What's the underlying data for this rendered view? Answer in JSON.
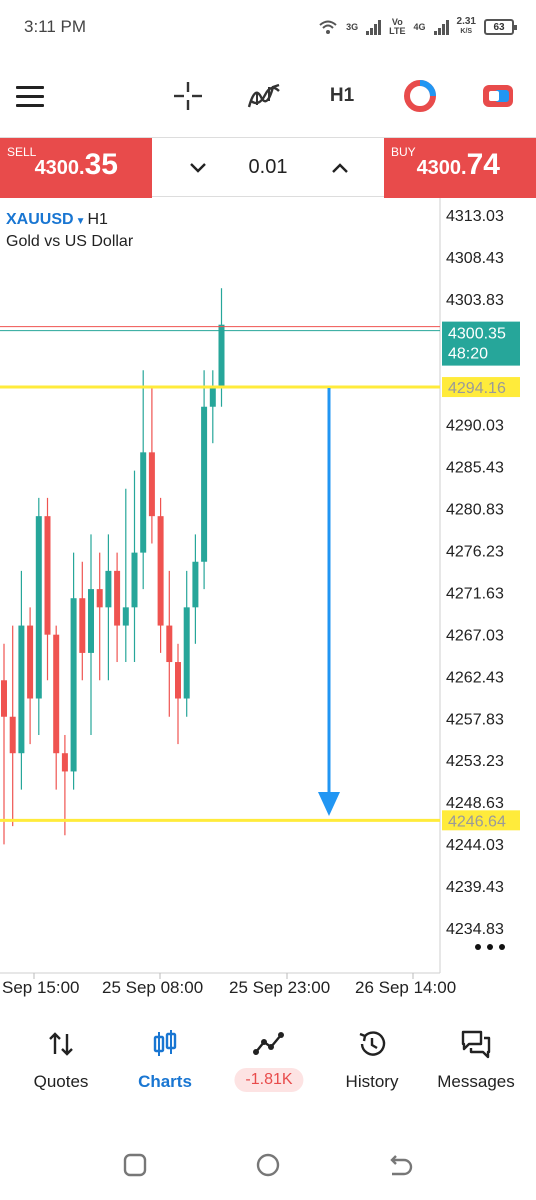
{
  "status_bar": {
    "time": "3:11 PM",
    "net1": "3G",
    "net2_top": "Vo",
    "net2_bottom": "LTE",
    "net3": "4G",
    "speed": "2.31",
    "speed_unit": "K/S",
    "battery": "63"
  },
  "toolbar": {
    "timeframe": "H1",
    "icons": [
      "menu-icon",
      "crosshair-icon",
      "indicators-icon",
      "timeframe-selector",
      "chart-type-icon",
      "trade-icon"
    ]
  },
  "trade": {
    "sell_label": "SELL",
    "sell_price_small": "4300.",
    "sell_price_big": "35",
    "lot": "0.01",
    "buy_label": "BUY",
    "buy_price_small": "4300.",
    "buy_price_big": "74"
  },
  "chart": {
    "symbol": "XAUUSD",
    "timeframe": "H1",
    "description": "Gold vs US Dollar",
    "price_ticks": [
      "4313.03",
      "4308.43",
      "4303.83",
      "4290.03",
      "4285.43",
      "4280.83",
      "4276.23",
      "4271.63",
      "4267.03",
      "4262.43",
      "4257.83",
      "4253.23",
      "4248.63",
      "4244.03",
      "4239.43",
      "4234.83"
    ],
    "current_bid": "4300.35",
    "countdown": "48:20",
    "hline_upper": "4294.16",
    "hline_lower": "4246.64",
    "time_labels": [
      "Sep 15:00",
      "25 Sep 08:00",
      "25 Sep 23:00",
      "26 Sep 14:00"
    ],
    "colors": {
      "bull": "#26a69a",
      "bear": "#ef5350",
      "hline": "#ffeb3b",
      "arrow": "#2196f3",
      "bid_label": "#26a69a"
    }
  },
  "chart_data": {
    "type": "candlestick",
    "candles": [
      {
        "o": 4262,
        "h": 4266,
        "l": 4244,
        "c": 4258
      },
      {
        "o": 4258,
        "h": 4268,
        "l": 4246,
        "c": 4254
      },
      {
        "o": 4254,
        "h": 4274,
        "l": 4250,
        "c": 4268
      },
      {
        "o": 4268,
        "h": 4270,
        "l": 4255,
        "c": 4260
      },
      {
        "o": 4260,
        "h": 4282,
        "l": 4256,
        "c": 4280
      },
      {
        "o": 4280,
        "h": 4282,
        "l": 4262,
        "c": 4267
      },
      {
        "o": 4267,
        "h": 4268,
        "l": 4250,
        "c": 4254
      },
      {
        "o": 4254,
        "h": 4256,
        "l": 4245,
        "c": 4252
      },
      {
        "o": 4252,
        "h": 4276,
        "l": 4250,
        "c": 4271
      },
      {
        "o": 4271,
        "h": 4275,
        "l": 4262,
        "c": 4265
      },
      {
        "o": 4265,
        "h": 4278,
        "l": 4256,
        "c": 4272
      },
      {
        "o": 4272,
        "h": 4276,
        "l": 4262,
        "c": 4270
      },
      {
        "o": 4270,
        "h": 4278,
        "l": 4262,
        "c": 4274
      },
      {
        "o": 4274,
        "h": 4276,
        "l": 4264,
        "c": 4268
      },
      {
        "o": 4268,
        "h": 4283,
        "l": 4264,
        "c": 4270
      },
      {
        "o": 4270,
        "h": 4285,
        "l": 4264,
        "c": 4276
      },
      {
        "o": 4276,
        "h": 4296,
        "l": 4272,
        "c": 4287
      },
      {
        "o": 4287,
        "h": 4294,
        "l": 4277,
        "c": 4280
      },
      {
        "o": 4280,
        "h": 4282,
        "l": 4265,
        "c": 4268
      },
      {
        "o": 4268,
        "h": 4274,
        "l": 4258,
        "c": 4264
      },
      {
        "o": 4264,
        "h": 4266,
        "l": 4255,
        "c": 4260
      },
      {
        "o": 4260,
        "h": 4274,
        "l": 4258,
        "c": 4270
      },
      {
        "o": 4270,
        "h": 4278,
        "l": 4266,
        "c": 4275
      },
      {
        "o": 4275,
        "h": 4296,
        "l": 4272,
        "c": 4292
      },
      {
        "o": 4292,
        "h": 4296,
        "l": 4288,
        "c": 4294
      },
      {
        "o": 4294,
        "h": 4305,
        "l": 4292,
        "c": 4301
      }
    ],
    "y_range": [
      4232,
      4315
    ],
    "current_price": 4300.35,
    "levels": [
      4294.16,
      4246.64
    ]
  },
  "bottom_nav": {
    "quotes": "Quotes",
    "charts": "Charts",
    "trade_pnl": "-1.81K",
    "history": "History",
    "messages": "Messages"
  }
}
